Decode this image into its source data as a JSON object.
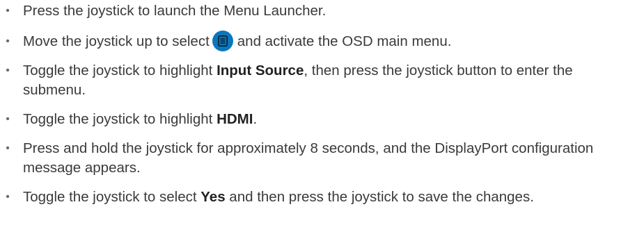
{
  "steps": [
    {
      "text": "Press the joystick to launch the Menu Launcher."
    },
    {
      "before": "Move the joystick up to select",
      "icon": "menu-icon",
      "after": "and activate the OSD main menu."
    },
    {
      "before": "Toggle the joystick to highlight ",
      "bold": "Input Source",
      "after": ", then press the joystick button to enter the submenu."
    },
    {
      "before": "Toggle the joystick to highlight ",
      "bold": "HDMI",
      "after": "."
    },
    {
      "text": "Press and hold the joystick for approximately 8 seconds, and the DisplayPort configuration message appears."
    },
    {
      "before": "Toggle the joystick to select ",
      "bold": "Yes",
      "after": " and then press the joystick to save the changes."
    }
  ],
  "colors": {
    "text": "#3a3a3a",
    "icon_bg": "#0a77bd"
  }
}
